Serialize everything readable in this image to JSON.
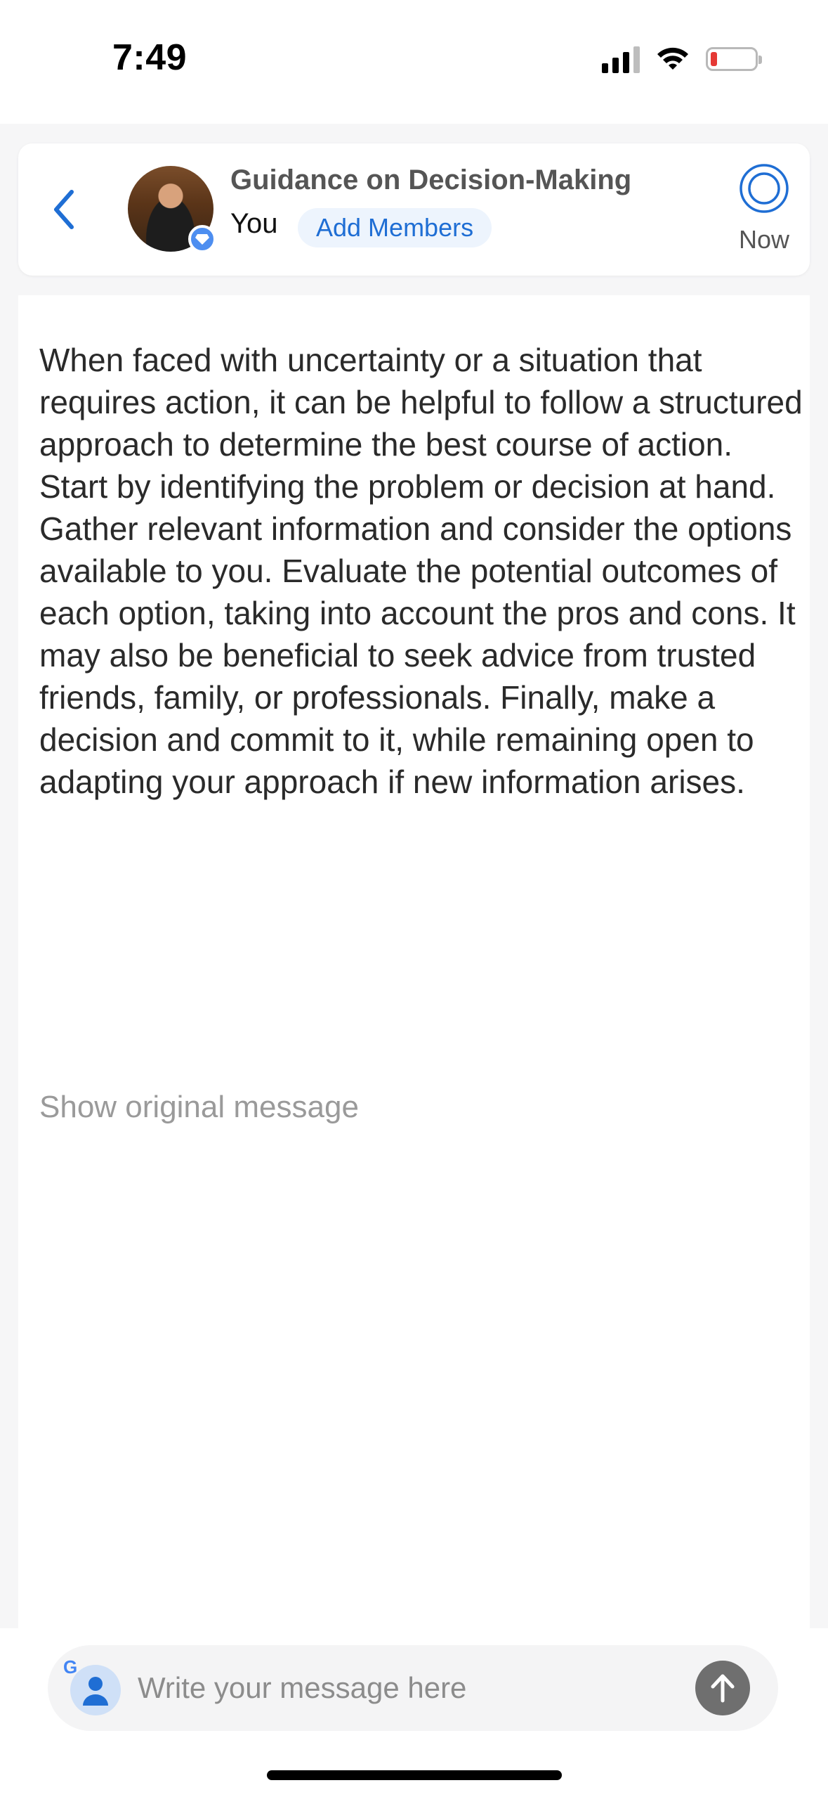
{
  "status_bar": {
    "time": "7:49",
    "battery_color": "#e53935"
  },
  "header": {
    "back_icon": "chevron-left-icon",
    "title": "Guidance on Decision-Making",
    "participant": "You",
    "add_members_label": "Add Members",
    "timer_label": "Now",
    "accent_color": "#1f6ed4"
  },
  "message": {
    "text": "When faced with uncertainty or a situation that requires action, it can be helpful to follow a structured approach to determine the best course of action. Start by identifying the problem or decision at hand. Gather relevant information and consider the options available to you. Evaluate the potential outcomes of each option, taking into account the pros and cons. It may also be beneficial to seek advice from trusted friends, family, or professionals. Finally, make a decision and commit to it, while remaining open to adapting your approach if new information arises.",
    "show_original_label": "Show original message"
  },
  "composer": {
    "placeholder": "Write your message here",
    "google_badge": "G",
    "send_icon": "arrow-up-icon"
  }
}
